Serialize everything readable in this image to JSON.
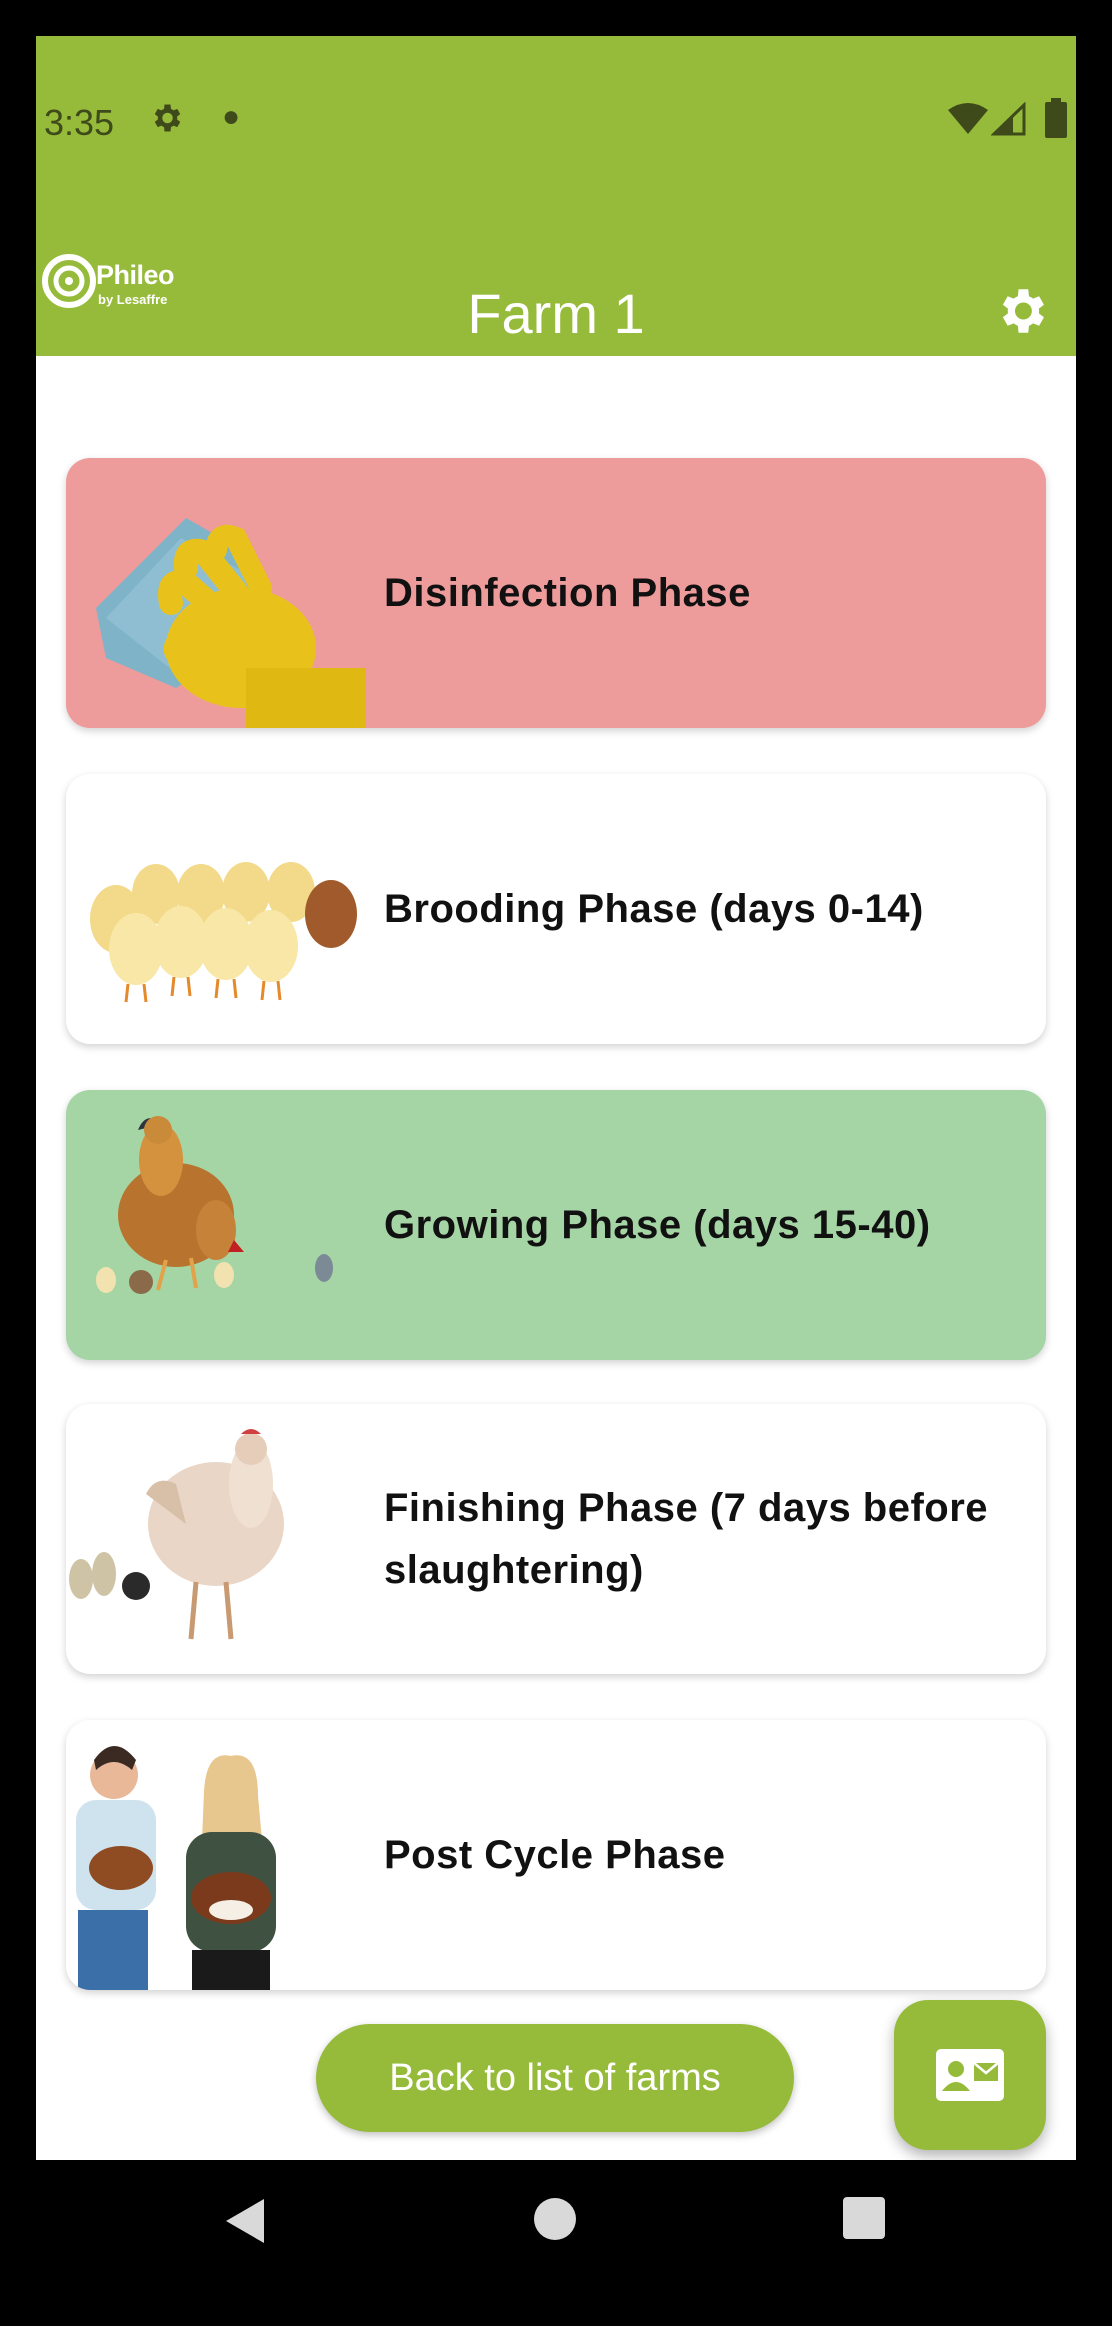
{
  "status_bar": {
    "time": "3:35",
    "icons": [
      "settings-gear-icon",
      "notification-dot-icon",
      "wifi-icon",
      "signal-icon",
      "battery-icon"
    ]
  },
  "app_bar": {
    "title": "Farm 1",
    "logo": {
      "name": "Phileo",
      "sub": "by Lesaffre"
    },
    "settings_icon": "gear-icon",
    "background": "#96BB3A"
  },
  "phases": [
    {
      "label": "Disinfection Phase",
      "image": "glove-cleaning-image",
      "background": "#EE9B9B"
    },
    {
      "label": "Brooding Phase (days 0-14)",
      "image": "chicks-image",
      "background": "#FFFFFF"
    },
    {
      "label": "Growing Phase (days 15-40)",
      "image": "hen-with-chicks-image",
      "background": "#A5D5A5"
    },
    {
      "label": "Finishing Phase (7 days before slaughtering)",
      "image": "chicken-image",
      "background": "#FFFFFF"
    },
    {
      "label": "Post Cycle Phase",
      "image": "farmers-holding-hens-image",
      "background": "#FFFFFF"
    }
  ],
  "actions": {
    "back_label": "Back to list of farms",
    "contact_icon": "contact-card-icon"
  },
  "nav_bar": {
    "icons": [
      "back-triangle-icon",
      "home-circle-icon",
      "recents-square-icon"
    ]
  }
}
